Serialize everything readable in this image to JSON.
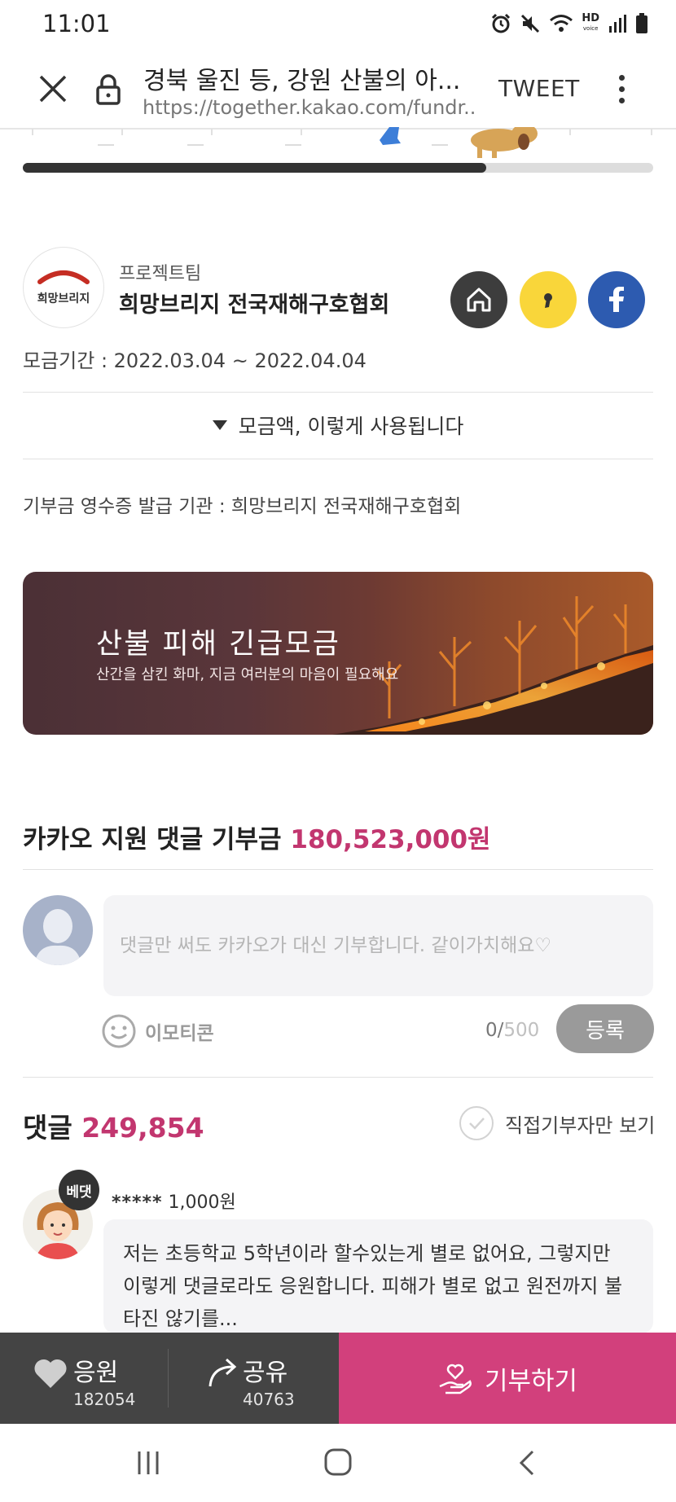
{
  "status_bar": {
    "time": "11:01",
    "hd_label": "HD",
    "voice_label": "voice"
  },
  "browser": {
    "title": "경북 울진 등, 강원 산불의 아...",
    "url": "https://together.kakao.com/fundr...",
    "tweet_label": "TWEET"
  },
  "progress": {
    "fraction": 0.735
  },
  "organization": {
    "logo_text": "희망브리지",
    "label": "프로젝트팀",
    "name": "희망브리지 전국재해구호협회"
  },
  "fundraising": {
    "period": "모금기간 : 2022.03.04 ~ 2022.04.04",
    "usage_toggle_label": "모금액, 이렇게 사용됩니다",
    "receipt_issuer": "기부금 영수증 발급 기관 : 희망브리지 전국재해구호협회"
  },
  "banner": {
    "title": "산불 피해 긴급모금",
    "subtitle": "산간을 삼킨 화마, 지금 여러분의 마음이 필요해요"
  },
  "donation": {
    "label": "카카오 지원 댓글 기부금",
    "amount": "180,523,000원"
  },
  "comment_form": {
    "placeholder": "댓글만 써도 카카오가 대신 기부합니다. 같이가치해요♡",
    "emoticon_label": "이모티콘",
    "char_current": "0",
    "char_max": "500",
    "submit_label": "등록"
  },
  "comments": {
    "label": "댓글",
    "count": "249,854",
    "filter_label": "직접기부자만 보기",
    "items": [
      {
        "badge": "베댓",
        "name": "*****",
        "amount": "1,000원",
        "text": "저는 초등학교 5학년이라 할수있는게 별로 없어요, 그렇지만 이렇게 댓글로라도 응원합니다. 피해가 별로 없고 원전까지 불타진 않기를..."
      }
    ]
  },
  "actions": {
    "cheer_label": "응원",
    "cheer_count": "182054",
    "share_label": "공유",
    "share_count": "40763",
    "donate_label": "기부하기"
  },
  "colors": {
    "accent": "#c2366f",
    "donate_button": "#d2407c",
    "kakao_yellow": "#f9d63a",
    "facebook_blue": "#2d5bb0",
    "action_bar": "#444444"
  }
}
